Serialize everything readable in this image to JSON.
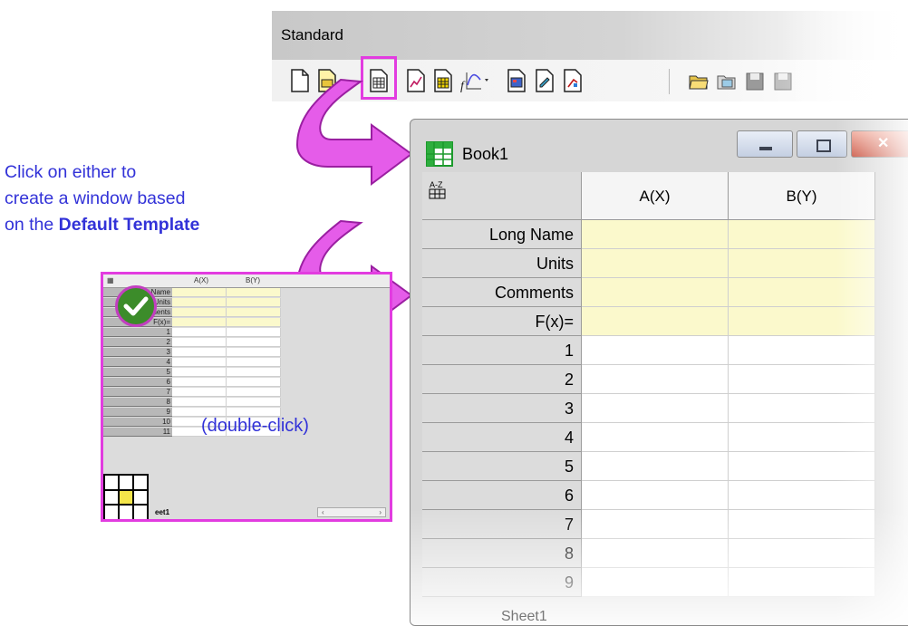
{
  "toolbar": {
    "title": "Standard",
    "icons": [
      "new-project-icon",
      "new-folder-icon",
      "new-workbook-icon",
      "new-graph-icon",
      "new-matrix-icon",
      "new-function-icon",
      "new-layout-icon",
      "new-notes-icon",
      "new-excel-icon",
      "open-icon",
      "open-template-icon",
      "save-project-icon",
      "save-template-icon"
    ]
  },
  "caption": {
    "line1": "Click on either to",
    "line2": "create a window based",
    "line3_prefix": "on the ",
    "line3_bold": "Default Template"
  },
  "thumbnail": {
    "col_a": "A(X)",
    "col_b": "B(Y)",
    "row_labels": [
      "Long Name",
      "Units",
      "Comments",
      "F(x)=",
      "1",
      "2",
      "3",
      "4",
      "5",
      "6",
      "7",
      "8",
      "9",
      "10",
      "11"
    ],
    "hint": "(double-click)",
    "sheet_tab": "eet1"
  },
  "book": {
    "title": "Book1",
    "columns": [
      "A(X)",
      "B(Y)"
    ],
    "row_labels": [
      "Long Name",
      "Units",
      "Comments",
      "F(x)=",
      "1",
      "2",
      "3",
      "4",
      "5",
      "6",
      "7",
      "8",
      "9"
    ],
    "sheet_tab": "Sheet1"
  },
  "colors": {
    "accent_magenta": "#e23ce0",
    "caption_blue": "#3232d8",
    "meta_row_yellow": "#fbf9cc"
  }
}
